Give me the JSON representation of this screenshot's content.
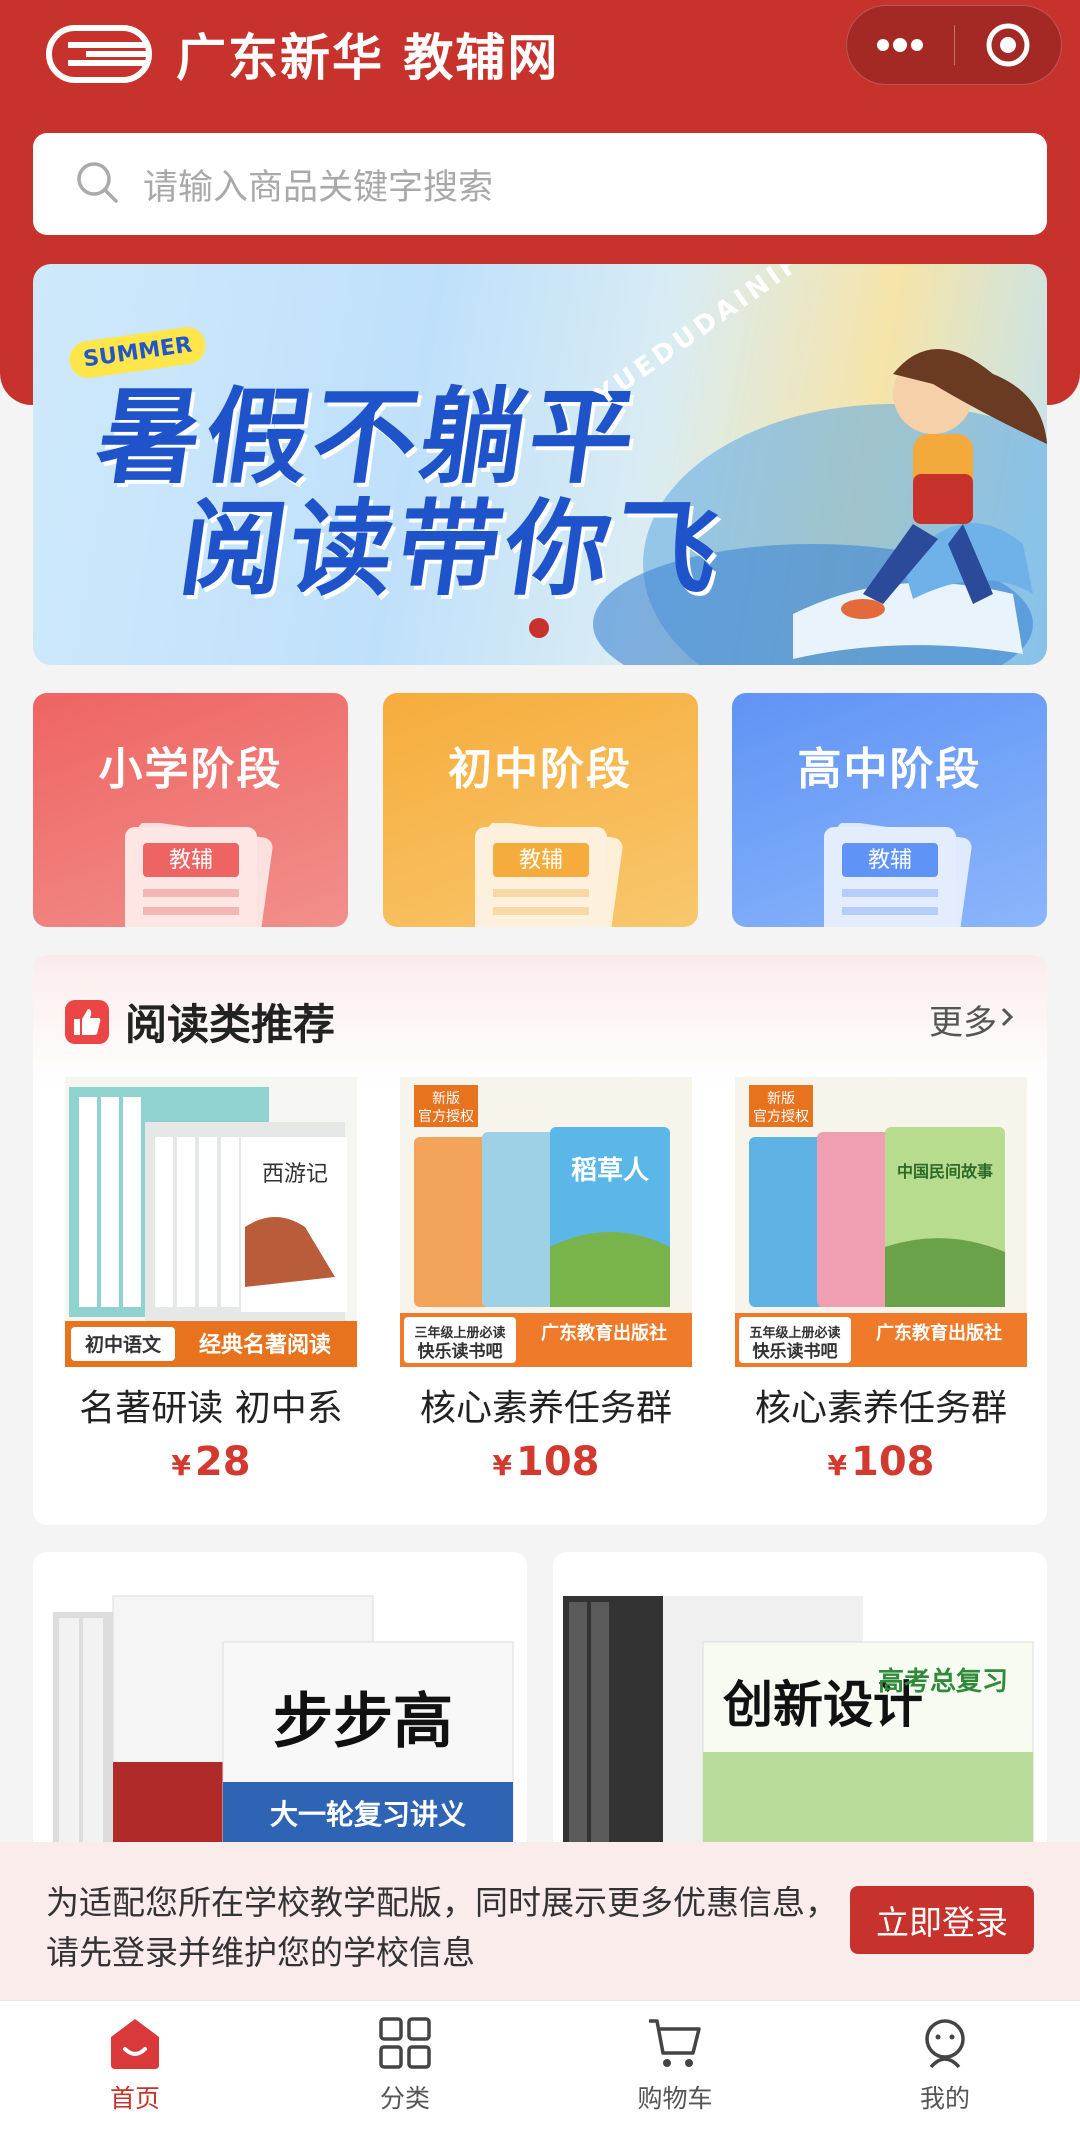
{
  "header": {
    "logo_text": "广东新华 教辅网",
    "capsule": {
      "more_icon": "more-dots-icon",
      "close_icon": "target-icon"
    }
  },
  "search": {
    "placeholder": "请输入商品关键字搜索",
    "icon": "search-icon"
  },
  "banner": {
    "tag": "SUMMER",
    "line1": "暑假不躺平",
    "line2": "阅读带你飞",
    "arc_text": "YUEDUDAINIFEI",
    "active_dot": 1,
    "dot_color": "#c8322c"
  },
  "stages": [
    {
      "label": "小学阶段",
      "badge": "教辅",
      "color": "#ee6462"
    },
    {
      "label": "初中阶段",
      "badge": "教辅",
      "color": "#f6ac3c"
    },
    {
      "label": "高中阶段",
      "badge": "教辅",
      "color": "#5f93f5"
    }
  ],
  "recommend": {
    "title": "阅读类推荐",
    "more": "更多",
    "products": [
      {
        "name": "名著研读 初中系",
        "price": "28",
        "currency": "¥",
        "tag_left": "初中语文",
        "tag_right": "经典名著阅读",
        "cover_text": "西游记"
      },
      {
        "name": "核心素养任务群",
        "price": "108",
        "currency": "¥",
        "tag_left": "三年级上册必读\n快乐读书吧",
        "tag_right": "广东教育出版社",
        "corner": "新版\n官方授权",
        "cover_text": "稻草人"
      },
      {
        "name": "核心素养任务群",
        "price": "108",
        "currency": "¥",
        "tag_left": "五年级上册必读\n快乐读书吧",
        "tag_right": "广东教育出版社",
        "corner": "新版\n官方授权",
        "cover_text": "中国民间故事"
      }
    ]
  },
  "grid_products": [
    {
      "cover_title": "步步高",
      "subtitle": "大一轮复习讲义"
    },
    {
      "cover_title": "创新设计",
      "subtitle": "高考总复习"
    }
  ],
  "login_prompt": {
    "text": "为适配您所在学校教学配版，同时展示更多优惠信息，请先登录并维护您的学校信息",
    "button": "立即登录"
  },
  "tabbar": [
    {
      "label": "首页",
      "icon": "home-icon",
      "active": true
    },
    {
      "label": "分类",
      "icon": "category-icon",
      "active": false
    },
    {
      "label": "购物车",
      "icon": "cart-icon",
      "active": false
    },
    {
      "label": "我的",
      "icon": "profile-icon",
      "active": false
    }
  ],
  "colors": {
    "brand": "#c8322c",
    "price": "#d33a2f"
  }
}
